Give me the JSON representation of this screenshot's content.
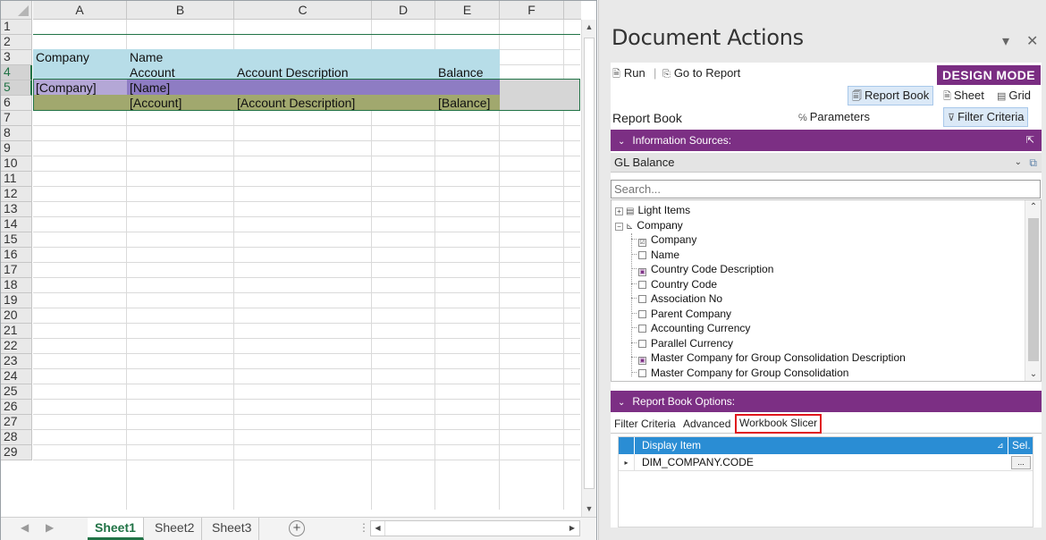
{
  "spreadsheet": {
    "columns": [
      "A",
      "B",
      "C",
      "D",
      "E",
      "F"
    ],
    "rows": [
      "1",
      "2",
      "3",
      "4",
      "5",
      "6",
      "7",
      "8",
      "9",
      "10",
      "11",
      "12",
      "13",
      "14",
      "15",
      "16",
      "17",
      "18",
      "19",
      "20",
      "21",
      "22",
      "23",
      "24",
      "25",
      "26",
      "27",
      "28",
      "29"
    ],
    "cells": {
      "a2": "Company",
      "b2": "Name",
      "b3": "Account",
      "c3": "Account Description",
      "e3": "Balance",
      "a4": "[Company]",
      "b4": "[Name]",
      "b5": "[Account]",
      "c5": "[Account Description]",
      "e5": "[Balance]"
    },
    "colors": {
      "header_fill": "#b7dde8",
      "row4_a_fill": "#b4a7d6",
      "row4_fill": "#8e7cc3",
      "row5_fill": "#a1a86e",
      "selection": "#217346"
    },
    "sheet_tabs": [
      "Sheet1",
      "Sheet2",
      "Sheet3"
    ],
    "active_tab": "Sheet1",
    "add_sheet_icon": "plus-circle-icon"
  },
  "panel": {
    "title": "Document Actions",
    "toolbar": {
      "run": "Run",
      "go_to_report": "Go to Report",
      "mode": "DESIGN MODE",
      "report_book": "Report Book",
      "sheet": "Sheet",
      "grid": "Grid",
      "parameters": "Parameters",
      "filter_criteria": "Filter Criteria"
    },
    "section_label": "Report Book",
    "info_sources": {
      "header": "Information Sources:",
      "selected": "GL Balance",
      "search_placeholder": "Search...",
      "tree": [
        {
          "label": "Light Items",
          "level": 0
        },
        {
          "label": "Company",
          "level": 0
        },
        {
          "label": "Company",
          "level": 1,
          "state": "checked"
        },
        {
          "label": "Name",
          "level": 1,
          "state": "unchecked"
        },
        {
          "label": "Country Code Description",
          "level": 1,
          "state": "partial"
        },
        {
          "label": "Country Code",
          "level": 1,
          "state": "unchecked"
        },
        {
          "label": "Association No",
          "level": 1,
          "state": "unchecked"
        },
        {
          "label": "Parent Company",
          "level": 1,
          "state": "unchecked"
        },
        {
          "label": "Accounting Currency",
          "level": 1,
          "state": "unchecked"
        },
        {
          "label": "Parallel Currency",
          "level": 1,
          "state": "unchecked"
        },
        {
          "label": "Master Company for Group Consolidation Description",
          "level": 1,
          "state": "partial"
        },
        {
          "label": "Master Company for Group Consolidation",
          "level": 1,
          "state": "unchecked"
        }
      ]
    },
    "options": {
      "header": "Report Book Options:",
      "tabs": [
        "Filter Criteria",
        "Advanced",
        "Workbook Slicer"
      ],
      "active_tab": "Workbook Slicer",
      "grid": {
        "col_display": "Display Item",
        "col_sel": "Sel.",
        "row_value": "DIM_COMPANY.CODE",
        "row_btn": "..."
      }
    },
    "colors": {
      "accent": "#7c2f84",
      "grid_header": "#2a8dd4",
      "highlight_border": "#e0171d"
    }
  }
}
